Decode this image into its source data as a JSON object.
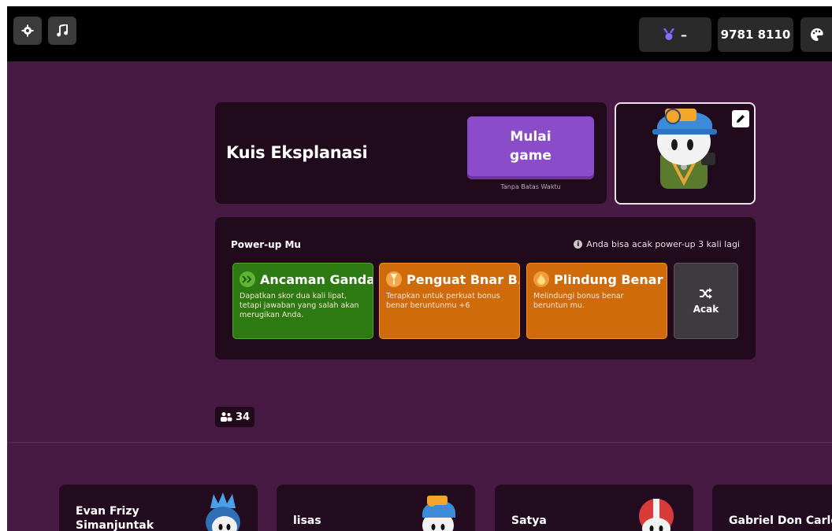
{
  "topbar": {
    "settings_icon": "gear-icon",
    "music_icon": "music-note-icon",
    "rank_icon": "medal-icon",
    "rank_value": "–",
    "game_code": "9781 8110",
    "theme_icon": "palette-icon"
  },
  "quiz": {
    "title": "Kuis Eksplanasi",
    "start_label": "Mulai game",
    "time_note": "Tanpa Batas Waktu"
  },
  "avatar": {
    "edit_icon": "pencil-icon"
  },
  "powerups": {
    "heading": "Power-up Mu",
    "shuffle_note": "Anda bisa acak power-up 3 kali lagi",
    "items": [
      {
        "title": "Ancaman Ganda",
        "description": "Dapatkan skor dua kali lipat, tetapi jawaban yang salah akan merugikan Anda.",
        "icon": "double-jeopardy-icon",
        "color": "#2e7a12"
      },
      {
        "title": "Penguat Bnar B...",
        "description": "Terapkan untuk perkuat bonus benar beruntunmu +6",
        "icon": "streak-booster-icon",
        "color": "#d06b0c"
      },
      {
        "title": "Plindung Benar ...",
        "description": "Melindungi bonus benar beruntun mu.",
        "icon": "flame-icon",
        "color": "#d06b0c"
      }
    ],
    "shuffle_label": "Acak",
    "shuffle_icon": "shuffle-icon"
  },
  "players": {
    "count": "34",
    "count_icon": "players-icon",
    "list": [
      {
        "name": "Evan Frizy Simanjuntak"
      },
      {
        "name": "lisas"
      },
      {
        "name": "Satya"
      },
      {
        "name": "Gabriel Don Carlos"
      }
    ]
  },
  "colors": {
    "background": "#461a42",
    "card": "#200a1c",
    "accent_purple": "#8a4cc9",
    "green": "#2e7a12",
    "orange": "#d06b0c"
  }
}
